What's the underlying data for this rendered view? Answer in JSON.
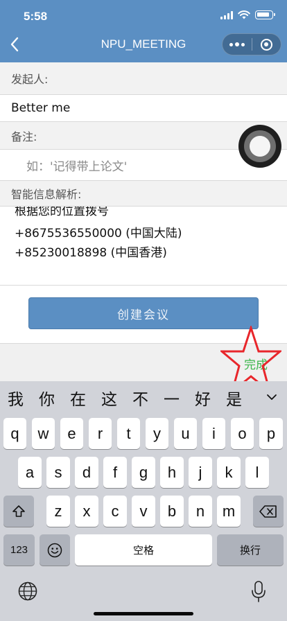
{
  "status_bar": {
    "time": "5:58"
  },
  "nav": {
    "title": "NPU_MEETING"
  },
  "form": {
    "initiator_label": "发起人:",
    "initiator_value": "Better me",
    "remark_label": "备注:",
    "remark_placeholder": "如：'记得带上论文'",
    "parse_label": "智能信息解析:",
    "parse_lines": [
      "根据您的位置拨号",
      "+8675536550000 (中国大陆)",
      "+85230018898 (中国香港)"
    ],
    "create_button": "创建会议",
    "done_button": "完成"
  },
  "keyboard": {
    "candidates": [
      "我",
      "你",
      "在",
      "这",
      "不",
      "一",
      "好",
      "是"
    ],
    "row1": [
      "q",
      "w",
      "e",
      "r",
      "t",
      "y",
      "u",
      "i",
      "o",
      "p"
    ],
    "row2": [
      "a",
      "s",
      "d",
      "f",
      "g",
      "h",
      "j",
      "k",
      "l"
    ],
    "row3": [
      "z",
      "x",
      "c",
      "v",
      "b",
      "n",
      "m"
    ],
    "numbers_key": "123",
    "space_key": "空格",
    "return_key": "换行"
  },
  "colors": {
    "header_bg": "#5b8fc3",
    "done_green": "#3cb64b",
    "highlight_star": "#e8262b"
  }
}
